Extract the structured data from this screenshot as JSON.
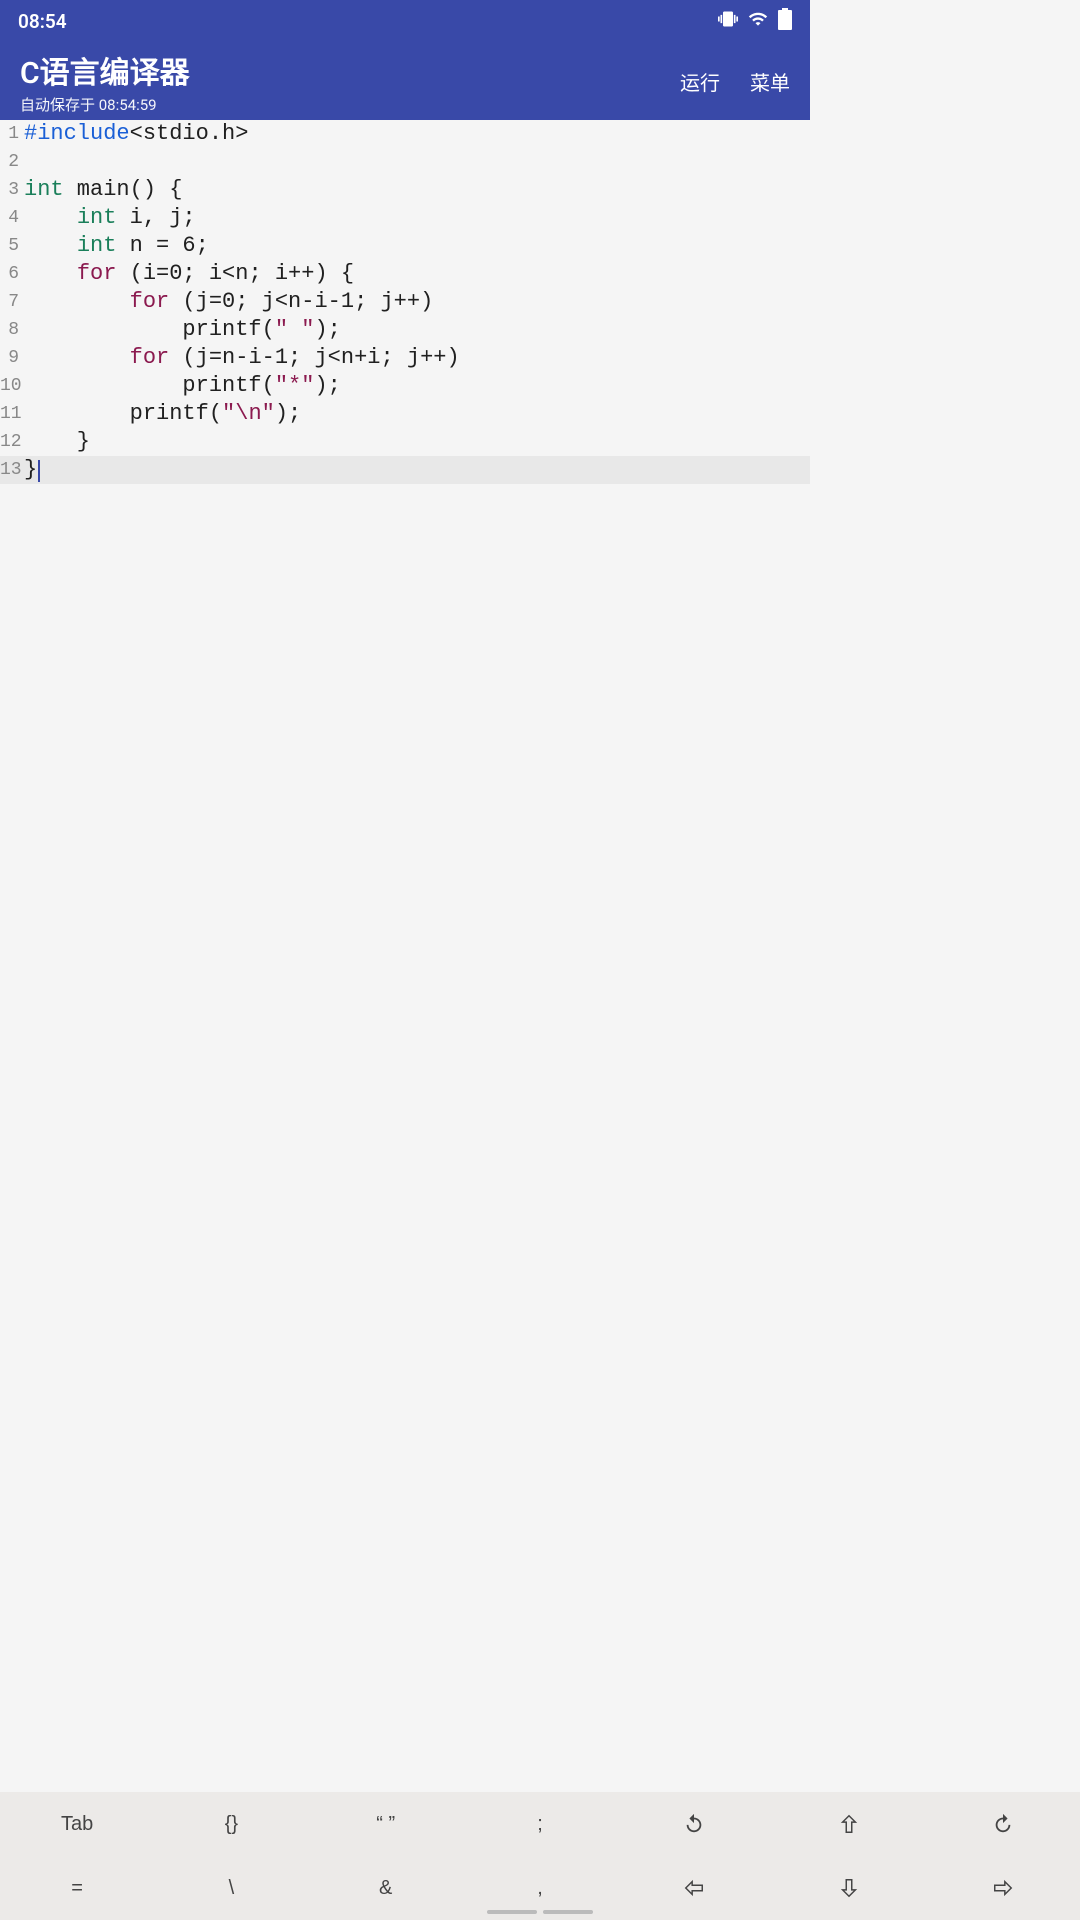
{
  "statusbar": {
    "time": "08:54"
  },
  "appbar": {
    "title": "C语言编译器",
    "subtitle": "自动保存于 08:54:59",
    "run": "运行",
    "menu": "菜单"
  },
  "code_lines": [
    {
      "n": "1",
      "tokens": [
        [
          "kw-pp",
          "#include"
        ],
        [
          "plain",
          "<stdio.h>"
        ]
      ]
    },
    {
      "n": "2",
      "tokens": []
    },
    {
      "n": "3",
      "tokens": [
        [
          "kw-type",
          "int"
        ],
        [
          "plain",
          " main() {"
        ]
      ]
    },
    {
      "n": "4",
      "tokens": [
        [
          "plain",
          "    "
        ],
        [
          "kw-type",
          "int"
        ],
        [
          "plain",
          " i, j;"
        ]
      ]
    },
    {
      "n": "5",
      "tokens": [
        [
          "plain",
          "    "
        ],
        [
          "kw-type",
          "int"
        ],
        [
          "plain",
          " n = 6;"
        ]
      ]
    },
    {
      "n": "6",
      "tokens": [
        [
          "plain",
          "    "
        ],
        [
          "kw-ctrl",
          "for"
        ],
        [
          "plain",
          " (i=0; i<n; i++) {"
        ]
      ]
    },
    {
      "n": "7",
      "tokens": [
        [
          "plain",
          "        "
        ],
        [
          "kw-ctrl",
          "for"
        ],
        [
          "plain",
          " (j=0; j<n-i-1; j++)"
        ]
      ]
    },
    {
      "n": "8",
      "tokens": [
        [
          "plain",
          "            printf("
        ],
        [
          "str",
          "\" \""
        ],
        [
          "plain",
          ");"
        ]
      ]
    },
    {
      "n": "9",
      "tokens": [
        [
          "plain",
          "        "
        ],
        [
          "kw-ctrl",
          "for"
        ],
        [
          "plain",
          " (j=n-i-1; j<n+i; j++)"
        ]
      ]
    },
    {
      "n": "10",
      "tokens": [
        [
          "plain",
          "            printf("
        ],
        [
          "str",
          "\"*\""
        ],
        [
          "plain",
          ");"
        ]
      ]
    },
    {
      "n": "11",
      "tokens": [
        [
          "plain",
          "        printf("
        ],
        [
          "str",
          "\"\\n\""
        ],
        [
          "plain",
          ");"
        ]
      ]
    },
    {
      "n": "12",
      "tokens": [
        [
          "plain",
          "    }"
        ]
      ]
    },
    {
      "n": "13",
      "tokens": [
        [
          "plain",
          "}"
        ]
      ],
      "active": true,
      "cursor": true
    }
  ],
  "toolbar_row1": [
    "Tab",
    "{}",
    "“ ”",
    ";",
    "undo-icon",
    "up-arrow-icon",
    "redo-icon"
  ],
  "toolbar_row2": [
    "=",
    "\\",
    "&",
    ",",
    "left-arrow-icon",
    "down-arrow-icon",
    "right-arrow-icon"
  ]
}
